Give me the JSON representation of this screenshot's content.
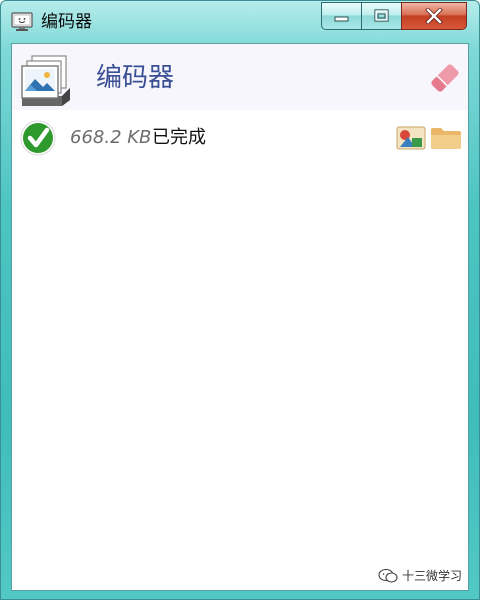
{
  "window": {
    "title": "编码器",
    "icon": "monitor-icon",
    "buttons": {
      "minimize": "minimize-icon",
      "maximize": "maximize-icon",
      "close": "close-icon"
    }
  },
  "header": {
    "title": "编码器",
    "icon": "image-stack-icon",
    "clear_icon": "eraser-icon"
  },
  "rows": [
    {
      "size": "668.2 KB",
      "status": "已完成",
      "status_icon": "check-icon",
      "actions": [
        "image-icon",
        "folder-icon"
      ]
    }
  ],
  "watermark": {
    "text": "十三微学习",
    "icon": "wechat-icon"
  },
  "colors": {
    "frame": "#4cc4c2",
    "header_title": "#3b4f95",
    "success": "#2e9a2e",
    "close_button": "#c94a2c",
    "eraser": "#e88ea0",
    "folder": "#f0c27a"
  }
}
